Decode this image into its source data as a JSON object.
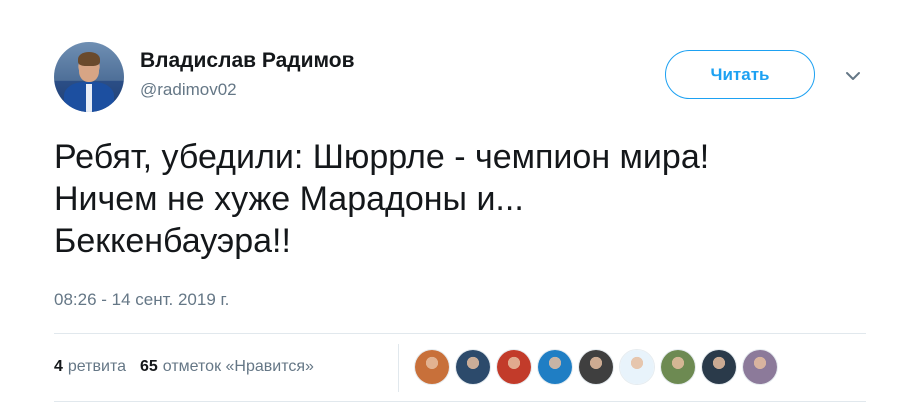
{
  "user": {
    "display_name": "Владислав Радимов",
    "handle": "@radimov02",
    "avatar_icon": "user-avatar-photo"
  },
  "follow_button": {
    "label": "Читать"
  },
  "menu": {
    "icon": "chevron-down-icon"
  },
  "tweet": {
    "lines": [
      "Ребят, убедили: Шюррле - чемпион мира!",
      "Ничем не хуже Марадоны и...",
      "Беккенбауэра!!"
    ],
    "timestamp": "08:26 - 14 сент. 2019 г."
  },
  "stats": {
    "retweets_count": "4",
    "retweets_label": "ретвита",
    "likes_count": "65",
    "likes_label": "отметок «Нравится»"
  },
  "likers": [
    {
      "name": "liker-avatar-1",
      "color": "#c8703a"
    },
    {
      "name": "liker-avatar-2",
      "color": "#2c4a6b"
    },
    {
      "name": "liker-avatar-3",
      "color": "#c23b2a"
    },
    {
      "name": "liker-avatar-4",
      "color": "#1f7ec4"
    },
    {
      "name": "liker-avatar-5",
      "color": "#3f3f3f"
    },
    {
      "name": "liker-avatar-6",
      "color": "#e8f3fb"
    },
    {
      "name": "liker-avatar-7",
      "color": "#6d8a52"
    },
    {
      "name": "liker-avatar-8",
      "color": "#2a3a4a"
    },
    {
      "name": "liker-avatar-9",
      "color": "#8c7a9a"
    }
  ],
  "colors": {
    "accent": "#1da1f2",
    "text_primary": "#14171a",
    "text_secondary": "#657786",
    "divider": "#e1e8ed"
  }
}
